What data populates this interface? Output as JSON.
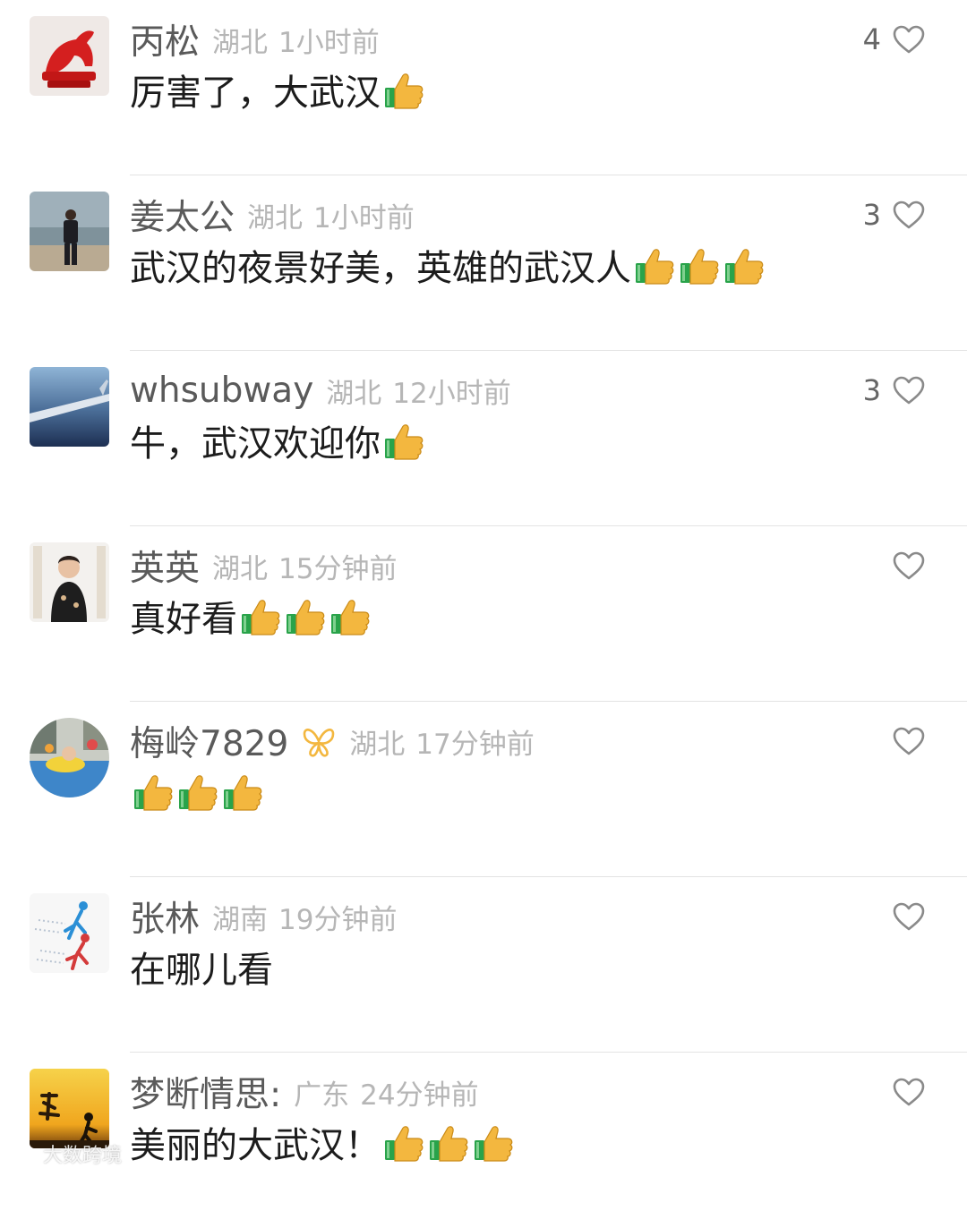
{
  "colors": {
    "username": "#5a5a5a",
    "meta": "#b6b6b6",
    "text": "#1c1c1c",
    "heart": "#8a8a8a",
    "thumb": "#f3b73f",
    "cuff": "#29a34a"
  },
  "comments": [
    {
      "username": "丙松",
      "location": "湖北",
      "time": "1小时前",
      "text": "厉害了，大武汉",
      "thumbs": 1,
      "likes": "4",
      "avatar_icon": "red-horse-statue"
    },
    {
      "username": "姜太公",
      "location": "湖北",
      "time": "1小时前",
      "text": "武汉的夜景好美，英雄的武汉人",
      "thumbs": 3,
      "likes": "3",
      "avatar_icon": "man-standing-by-sea"
    },
    {
      "username": "whsubway",
      "location": "湖北",
      "time": "12小时前",
      "text": "牛，武汉欢迎你",
      "thumbs": 1,
      "likes": "3",
      "avatar_icon": "airplane-wing-sky"
    },
    {
      "username": "英英",
      "location": "湖北",
      "time": "15分钟前",
      "text": "真好看",
      "thumbs": 3,
      "likes": "",
      "avatar_icon": "woman-portrait"
    },
    {
      "username": "梅岭7829",
      "location": "湖北",
      "time": "17分钟前",
      "text": "",
      "thumbs": 3,
      "likes": "",
      "avatar_icon": "child-swimming-pool",
      "badge_icon": "butterfly-badge-icon"
    },
    {
      "username": "张林",
      "location": "湖南",
      "time": "19分钟前",
      "text": "在哪儿看",
      "thumbs": 0,
      "likes": "",
      "avatar_icon": "running-figures"
    },
    {
      "username": "梦断情思:",
      "location": "广东",
      "time": "24分钟前",
      "text": "美丽的大武汉！",
      "thumbs": 3,
      "likes": "",
      "avatar_icon": "sunset-calligraphy"
    }
  ],
  "watermark": {
    "text": "大数跨境"
  }
}
